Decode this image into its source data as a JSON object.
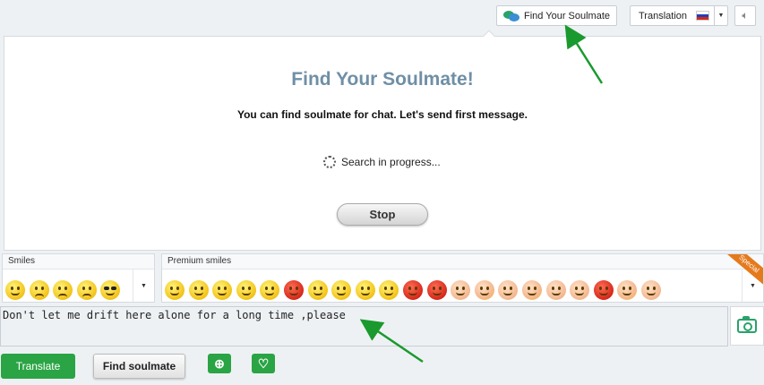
{
  "topbar": {
    "find_soulmate_label": "Find Your Soulmate",
    "translation_label": "Translation",
    "chat_icon": "chat-bubbles-icon",
    "flag_icon": "russia-flag-icon",
    "volume_icon": "speaker-icon"
  },
  "main": {
    "title": "Find Your Soulmate!",
    "subtitle": "You can find soulmate for chat. Let's send first message.",
    "progress_text": "Search in progress...",
    "stop_label": "Stop"
  },
  "smiles": {
    "header": "Smiles",
    "items": [
      "smile",
      "frown",
      "worried",
      "sad",
      "cool"
    ]
  },
  "premium": {
    "header": "Premium smiles",
    "ribbon": "Special",
    "items": [
      "smile",
      "kiss",
      "grin",
      "kissing-couple",
      "laughing",
      "angry",
      "sleepy",
      "smile",
      "grin",
      "angel",
      "devil",
      "devil",
      "boy",
      "girl",
      "boy",
      "girl",
      "boy",
      "family",
      "devil-girl",
      "angel-girl",
      "police"
    ]
  },
  "input": {
    "value": "Don't let me drift here alone for a long time ,please"
  },
  "actions": {
    "translate_label": "Translate",
    "find_soulmate_label": "Find soulmate",
    "add_icon": "add-chat-icon",
    "heart_icon": "add-favorite-heart-icon"
  },
  "colors": {
    "accent_green": "#2aa444",
    "title_blue": "#6f8fa6",
    "annotation_arrow": "#1a9a2e"
  }
}
